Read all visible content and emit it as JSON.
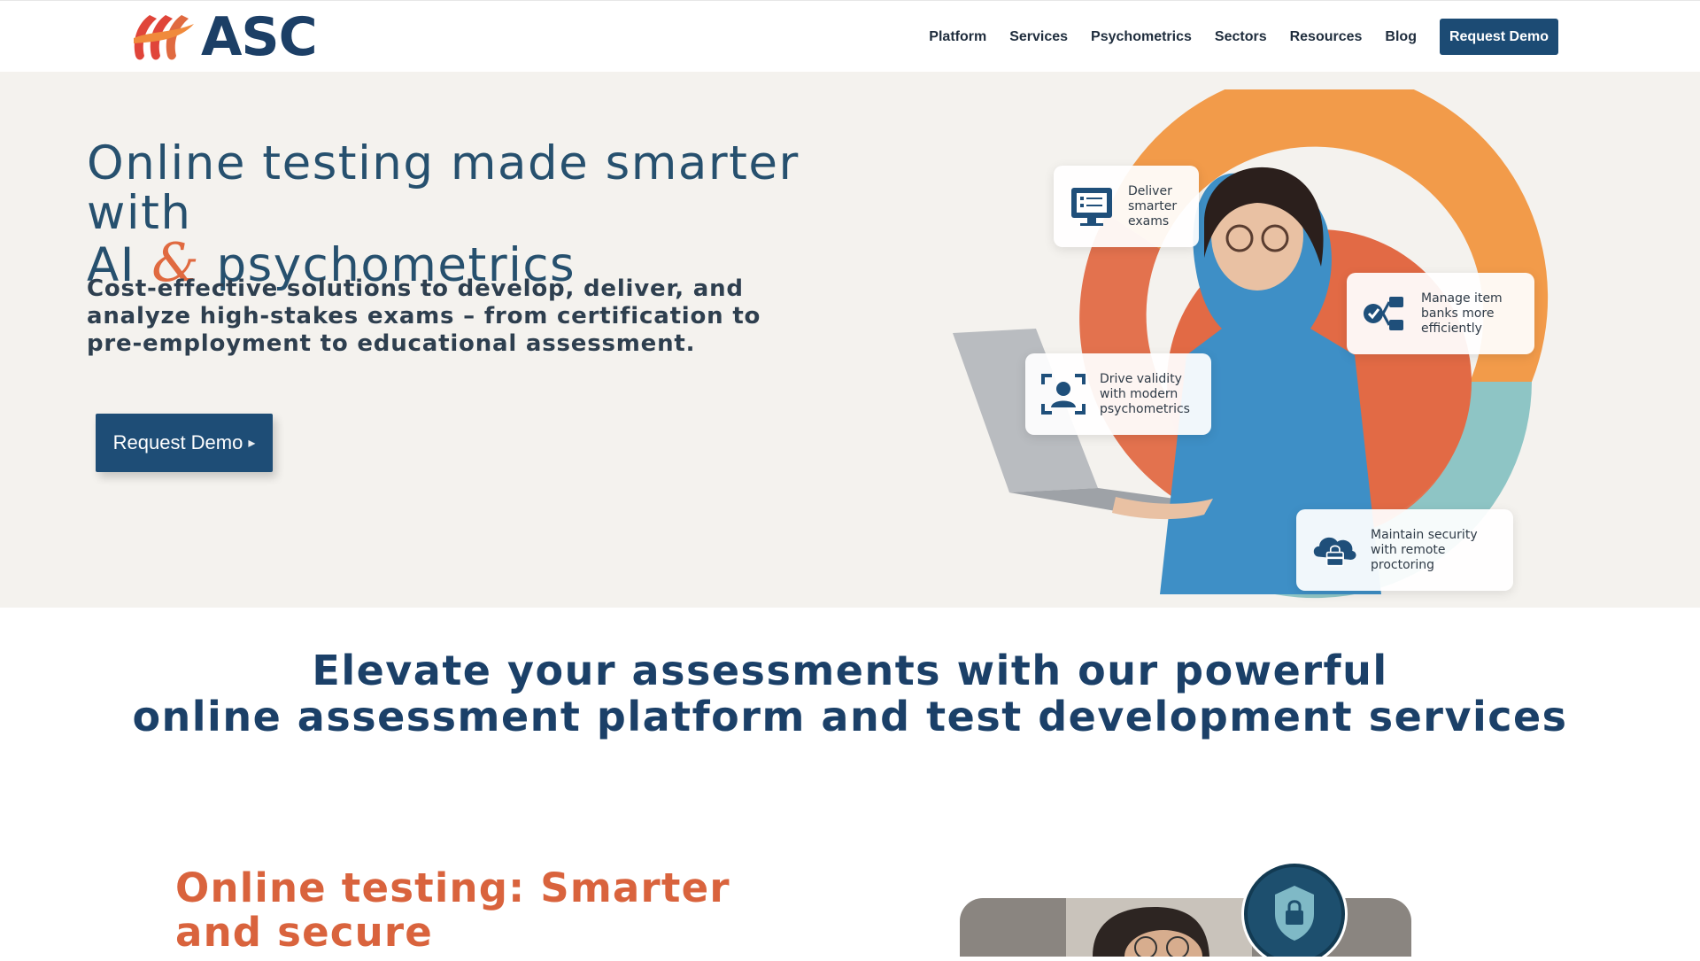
{
  "brand": {
    "name": "ASC"
  },
  "nav": {
    "items": [
      "Platform",
      "Services",
      "Psychometrics",
      "Sectors",
      "Resources",
      "Blog"
    ],
    "cta": "Request Demo"
  },
  "hero": {
    "title_line1": "Online testing made smarter with",
    "title_ai": "AI",
    "title_amp": "&",
    "title_line2_rest": "psychometrics",
    "subtitle": "Cost-effective solutions to develop, deliver, and analyze high-stakes exams – from certification to pre-employment to educational assessment.",
    "button": "Request Demo",
    "button_icon": "arrow-icon",
    "cards": [
      {
        "text": "Deliver smarter exams",
        "icon": "exam-screen-icon"
      },
      {
        "text": "Manage item banks more efficiently",
        "icon": "item-bank-icon"
      },
      {
        "text": "Drive validity with modern psychometrics",
        "icon": "person-scan-icon"
      },
      {
        "text": "Maintain security with remote proctoring",
        "icon": "cloud-lock-icon"
      }
    ]
  },
  "section2": {
    "line1": "Elevate your assessments with our powerful",
    "line2": "online assessment platform and test development services"
  },
  "section3": {
    "title": "Online testing: Smarter and secure",
    "icon": "lock-shield-icon"
  },
  "colors": {
    "brand": "#1c3f66",
    "accent": "#e06a40",
    "button": "#1e4d76",
    "hero_bg": "#f4f2ee"
  }
}
